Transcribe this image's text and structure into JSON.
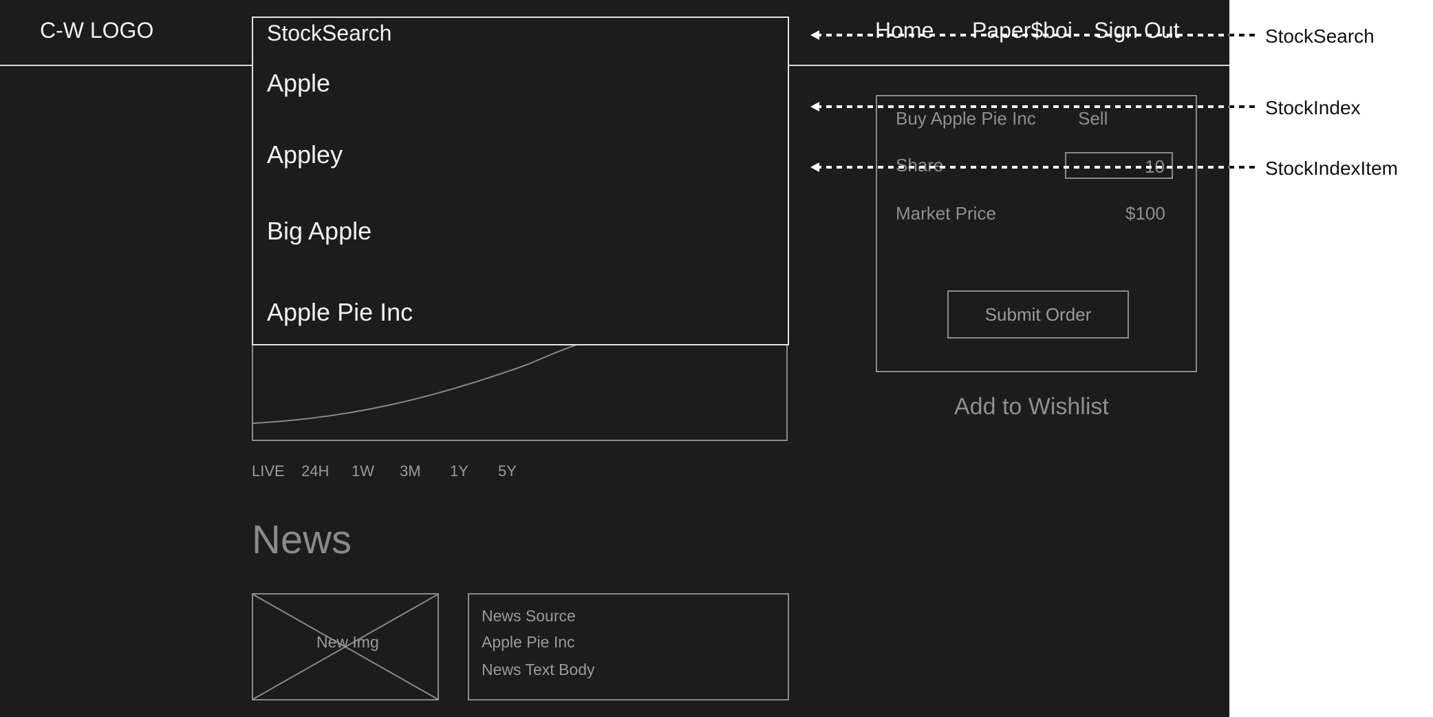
{
  "header": {
    "logo": "C-W LOGO",
    "search_label": "StockSearch",
    "nav": [
      "Home",
      "Paper$boi",
      "Sign Out"
    ]
  },
  "search_results": [
    "Apple",
    "Appley",
    "Big Apple",
    "Apple Pie Inc"
  ],
  "chart": {
    "ranges": [
      "LIVE",
      "24H",
      "1W",
      "3M",
      "1Y",
      "5Y"
    ]
  },
  "news": {
    "title": "News",
    "image_label": "New Img",
    "source": "News Source",
    "company": "Apple Pie Inc",
    "body": "News Text Body"
  },
  "order": {
    "buy_label": "Buy Apple Pie Inc",
    "sell_label": "Sell",
    "share_label": "Share",
    "share_value": "10",
    "market_price_label": "Market Price",
    "market_price_value": "$100",
    "submit_label": "Submit Order",
    "wishlist_label": "Add to Wishlist"
  },
  "annotations": [
    "StockSearch",
    "StockIndex",
    "StockIndexItem"
  ],
  "colors": {
    "background_dark": "#1c1b1f",
    "line_light": "#e6e6e6",
    "line_muted": "#8a8a8a",
    "annotation_text": "#111111"
  }
}
